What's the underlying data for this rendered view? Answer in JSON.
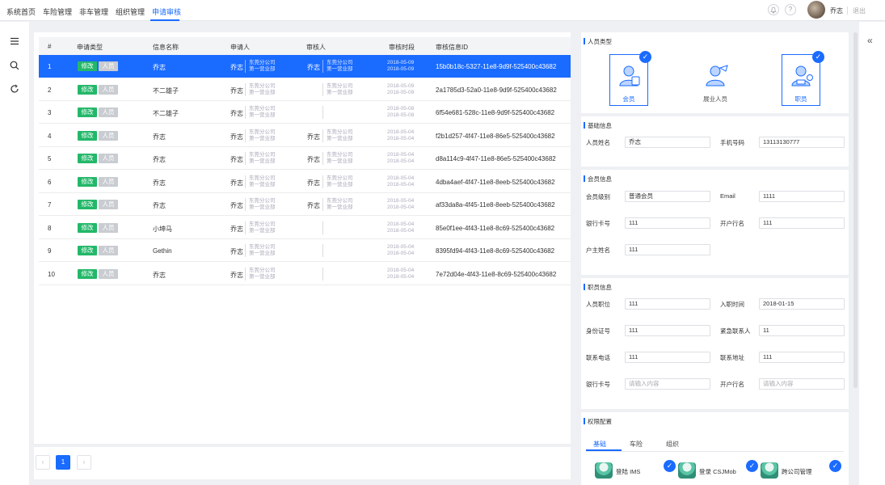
{
  "topnav": {
    "items": [
      "系统首页",
      "车险管理",
      "非车管理",
      "组织管理",
      "申请审核"
    ],
    "active_index": 4,
    "notification_icon": "bell-icon",
    "help_icon": "question-icon",
    "help_label": "?",
    "user_name": "乔志",
    "logout_label": "退出"
  },
  "leftbar": {
    "icons": [
      "menu-icon",
      "search-icon",
      "refresh-icon"
    ]
  },
  "rightbar": {
    "collapse_label": "«"
  },
  "table": {
    "headers": [
      "#",
      "申请类型",
      "信息名称",
      "申请人",
      "审核人",
      "审核时段",
      "审核信息ID"
    ],
    "edit_tag": "修改",
    "person_tag": "人员",
    "selected_index": 0,
    "rows": [
      {
        "no": "1",
        "name": "乔志",
        "applicant": "乔志",
        "app_org1": "东莞分公司",
        "app_org2": "第一营业部",
        "reviewer": "乔志",
        "rev_org1": "东莞分公司",
        "rev_org2": "第一营业部",
        "t1": "2018-05-09",
        "t2": "2018-05-09",
        "id": "15b0b18c-5327-11e8-9d9f-525400c43682"
      },
      {
        "no": "2",
        "name": "不二雄子",
        "applicant": "乔志",
        "app_org1": "东莞分公司",
        "app_org2": "第一营业部",
        "reviewer": "",
        "rev_org1": "东莞分公司",
        "rev_org2": "第一营业部",
        "t1": "2018-05-09",
        "t2": "2018-05-09",
        "id": "2a1785d3-52a0-11e8-9d9f-525400c43682"
      },
      {
        "no": "3",
        "name": "不二雄子",
        "applicant": "乔志",
        "app_org1": "东莞分公司",
        "app_org2": "第一营业部",
        "reviewer": "",
        "rev_org1": "",
        "rev_org2": "",
        "t1": "2018-05-08",
        "t2": "2018-05-08",
        "id": "6f54e681-528c-11e8-9d9f-525400c43682"
      },
      {
        "no": "4",
        "name": "乔志",
        "applicant": "乔志",
        "app_org1": "东莞分公司",
        "app_org2": "第一营业部",
        "reviewer": "乔志",
        "rev_org1": "东莞分公司",
        "rev_org2": "第一营业部",
        "t1": "2018-05-04",
        "t2": "2018-05-04",
        "id": "f2b1d257-4f47-11e8-86e5-525400c43682"
      },
      {
        "no": "5",
        "name": "乔志",
        "applicant": "乔志",
        "app_org1": "东莞分公司",
        "app_org2": "第一营业部",
        "reviewer": "乔志",
        "rev_org1": "东莞分公司",
        "rev_org2": "第一营业部",
        "t1": "2018-05-04",
        "t2": "2018-05-04",
        "id": "d8a114c9-4f47-11e8-86e5-525400c43682"
      },
      {
        "no": "6",
        "name": "乔志",
        "applicant": "乔志",
        "app_org1": "东莞分公司",
        "app_org2": "第一营业部",
        "reviewer": "乔志",
        "rev_org1": "东莞分公司",
        "rev_org2": "第一营业部",
        "t1": "2018-05-04",
        "t2": "2018-05-04",
        "id": "4dba4aef-4f47-11e8-8eeb-525400c43682"
      },
      {
        "no": "7",
        "name": "乔志",
        "applicant": "乔志",
        "app_org1": "东莞分公司",
        "app_org2": "第一营业部",
        "reviewer": "乔志",
        "rev_org1": "东莞分公司",
        "rev_org2": "第一营业部",
        "t1": "2018-05-04",
        "t2": "2018-05-04",
        "id": "af33da8a-4f45-11e8-8eeb-525400c43682"
      },
      {
        "no": "8",
        "name": "小坤马",
        "applicant": "乔志",
        "app_org1": "东莞分公司",
        "app_org2": "第一营业部",
        "reviewer": "",
        "rev_org1": "",
        "rev_org2": "",
        "t1": "2018-05-04",
        "t2": "2018-05-04",
        "id": "85e0f1ee-4f43-11e8-8c69-525400c43682"
      },
      {
        "no": "9",
        "name": "Gethin",
        "applicant": "乔志",
        "app_org1": "东莞分公司",
        "app_org2": "第一营业部",
        "reviewer": "",
        "rev_org1": "",
        "rev_org2": "",
        "t1": "2018-05-04",
        "t2": "2018-05-04",
        "id": "8395fd94-4f43-11e8-8c69-525400c43682"
      },
      {
        "no": "10",
        "name": "乔志",
        "applicant": "乔志",
        "app_org1": "东莞分公司",
        "app_org2": "第一营业部",
        "reviewer": "",
        "rev_org1": "",
        "rev_org2": "",
        "t1": "2018-05-04",
        "t2": "2018-05-04",
        "id": "7e72d04e-4f43-11e8-8c69-525400c43682"
      }
    ]
  },
  "pagination": {
    "prev": "‹",
    "current": "1",
    "next": "›"
  },
  "person_type": {
    "title": "人员类型",
    "cards": [
      {
        "label": "会员",
        "icon": "member-icon",
        "checked": true
      },
      {
        "label": "展业人员",
        "icon": "sales-agent-icon",
        "checked": false
      },
      {
        "label": "职员",
        "icon": "staff-icon",
        "checked": true
      }
    ]
  },
  "basic_info": {
    "title": "基础信息",
    "name_label": "人员姓名",
    "name_value": "乔志",
    "phone_label": "手机号码",
    "phone_value": "13113130777"
  },
  "member_info": {
    "title": "会员信息",
    "level_label": "会员级别",
    "level_value": "普通会员",
    "email_label": "Email",
    "email_value": "1111",
    "card_label": "银行卡号",
    "card_value": "111",
    "bank_label": "开户行名",
    "bank_value": "111",
    "holder_label": "户主姓名",
    "holder_value": "111"
  },
  "staff_info": {
    "title": "职员信息",
    "position_label": "人员职位",
    "position_value": "111",
    "join_label": "入职时间",
    "join_value": "2018-01-15",
    "idcard_label": "身份证号",
    "idcard_value": "111",
    "emergency_label": "紧急联系人",
    "emergency_value": "11",
    "tel_label": "联系电话",
    "tel_value": "111",
    "addr_label": "联系地址",
    "addr_value": "111",
    "card_label": "银行卡号",
    "card_placeholder": "请输入内容",
    "bank_label": "开户行名",
    "bank_placeholder": "请输入内容"
  },
  "permission": {
    "title": "权限配置",
    "tabs": [
      "基础",
      "车险",
      "组织"
    ],
    "active_tab": 0,
    "items": [
      {
        "label": "登陆 IMS",
        "checked": true
      },
      {
        "label": "登录 CSJMob",
        "checked": true
      },
      {
        "label": "跨公司管理",
        "checked": true
      }
    ]
  },
  "colors": {
    "accent": "#1a6bff",
    "success": "#23b869",
    "tag_gray": "#c9ccd1"
  }
}
